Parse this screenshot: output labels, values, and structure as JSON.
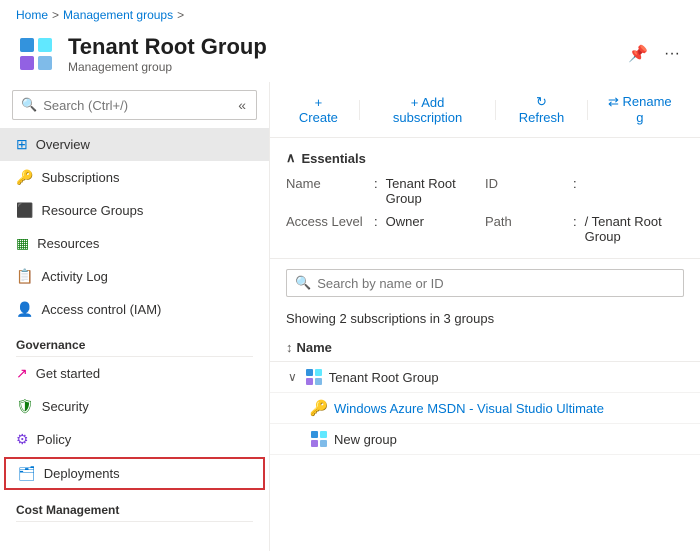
{
  "breadcrumb": {
    "home": "Home",
    "separator1": ">",
    "management_groups": "Management groups",
    "separator2": ">"
  },
  "header": {
    "title": "Tenant Root Group",
    "subtitle": "Management group",
    "pin_icon": "📌",
    "more_icon": "···"
  },
  "toolbar": {
    "create_label": "+ Create",
    "add_subscription_label": "+ Add subscription",
    "refresh_label": "↻ Refresh",
    "rename_label": "⇄ Rename g"
  },
  "essentials": {
    "section_label": "Essentials",
    "name_label": "Name",
    "name_value": "Tenant Root Group",
    "id_label": "ID",
    "id_value": ":",
    "access_level_label": "Access Level",
    "access_level_value": "Owner",
    "path_label": "Path",
    "path_value": "/ Tenant Root Group"
  },
  "content_search": {
    "placeholder": "Search by name or ID"
  },
  "showing_text": "Showing 2 subscriptions in 3 groups",
  "table": {
    "name_column": "Name",
    "items": [
      {
        "type": "group",
        "name": "Tenant Root Group",
        "expanded": true,
        "indent": 0
      },
      {
        "type": "subscription",
        "name": "Windows Azure MSDN - Visual Studio Ultimate",
        "link": true,
        "indent": 1
      },
      {
        "type": "group",
        "name": "New group",
        "link": false,
        "indent": 1
      }
    ]
  },
  "sidebar": {
    "search_placeholder": "Search (Ctrl+/)",
    "items": [
      {
        "id": "overview",
        "label": "Overview",
        "icon": "overview",
        "active": true
      },
      {
        "id": "subscriptions",
        "label": "Subscriptions",
        "icon": "subscriptions"
      },
      {
        "id": "resource-groups",
        "label": "Resource Groups",
        "icon": "resource-groups"
      },
      {
        "id": "resources",
        "label": "Resources",
        "icon": "resources"
      },
      {
        "id": "activity-log",
        "label": "Activity Log",
        "icon": "activity-log"
      },
      {
        "id": "access-control",
        "label": "Access control (IAM)",
        "icon": "access-control"
      }
    ],
    "governance_label": "Governance",
    "governance_items": [
      {
        "id": "get-started",
        "label": "Get started",
        "icon": "get-started"
      },
      {
        "id": "security",
        "label": "Security",
        "icon": "security"
      },
      {
        "id": "policy",
        "label": "Policy",
        "icon": "policy"
      },
      {
        "id": "deployments",
        "label": "Deployments",
        "icon": "deployments",
        "highlighted": true
      }
    ],
    "cost_management_label": "Cost Management"
  }
}
